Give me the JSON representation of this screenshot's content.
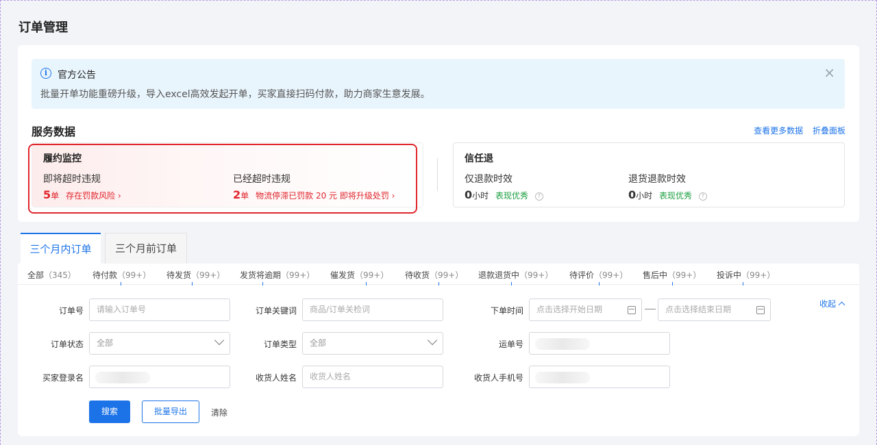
{
  "page_title": "订单管理",
  "notice": {
    "title": "官方公告",
    "text": "批量开单功能重磅升级，导入excel高效发起开单，买家直接扫码付款，助力商家生意发展。",
    "close": "×",
    "info_glyph": "i"
  },
  "service": {
    "title": "服务数据",
    "link_more": "查看更多数据",
    "link_fold": "折叠面板"
  },
  "monitor": {
    "title": "履约监控",
    "about_label": "即将超时违规",
    "about_count": "5",
    "about_unit": "单",
    "about_note": "存在罚款风险 ›",
    "over_label": "已经超时违规",
    "over_count": "2",
    "over_unit": "单",
    "over_note": "物流停滞已罚款 20 元 即将升级处罚 ›"
  },
  "trust": {
    "title": "信任退",
    "refund_label": "仅退款时效",
    "refund_value": "0",
    "refund_unit": "小时",
    "refund_status": "表现优秀",
    "return_label": "退货退款时效",
    "return_value": "0",
    "return_unit": "小时",
    "return_status": "表现优秀",
    "q": "?"
  },
  "tabs": {
    "active": "三个月内订单",
    "inactive": "三个月前订单"
  },
  "status_filters": [
    {
      "label": "全部",
      "count": "（345）"
    },
    {
      "label": "待付款",
      "count": "（99+）"
    },
    {
      "label": "待发货",
      "count": "（99+）"
    },
    {
      "label": "发货将逾期",
      "count": "（99+）"
    },
    {
      "label": "催发货",
      "count": "（99+）"
    },
    {
      "label": "待收货",
      "count": "（99+）"
    },
    {
      "label": "退款退货中",
      "count": "（99+）"
    },
    {
      "label": "待评价",
      "count": "（99+）"
    },
    {
      "label": "售后中",
      "count": "（99+）"
    },
    {
      "label": "投诉中",
      "count": "（99+）"
    }
  ],
  "form": {
    "order_no_label": "订单号",
    "order_no_placeholder": "请输入订单号",
    "keyword_label": "订单关键词",
    "keyword_placeholder": "商品/订单关检词",
    "time_label": "下单时间",
    "start_placeholder": "点击选择开始日期",
    "end_placeholder": "点击选择结束日期",
    "collapse": "收起",
    "status_label": "订单状态",
    "status_value": "全部",
    "type_label": "订单类型",
    "type_value": "全部",
    "waybill_label": "运单号",
    "buyer_label": "买家登录名",
    "receiver_label": "收货人姓名",
    "receiver_placeholder": "收货人姓名",
    "phone_label": "收货人手机号",
    "search": "搜索",
    "export": "批量导出",
    "clear": "清除"
  }
}
